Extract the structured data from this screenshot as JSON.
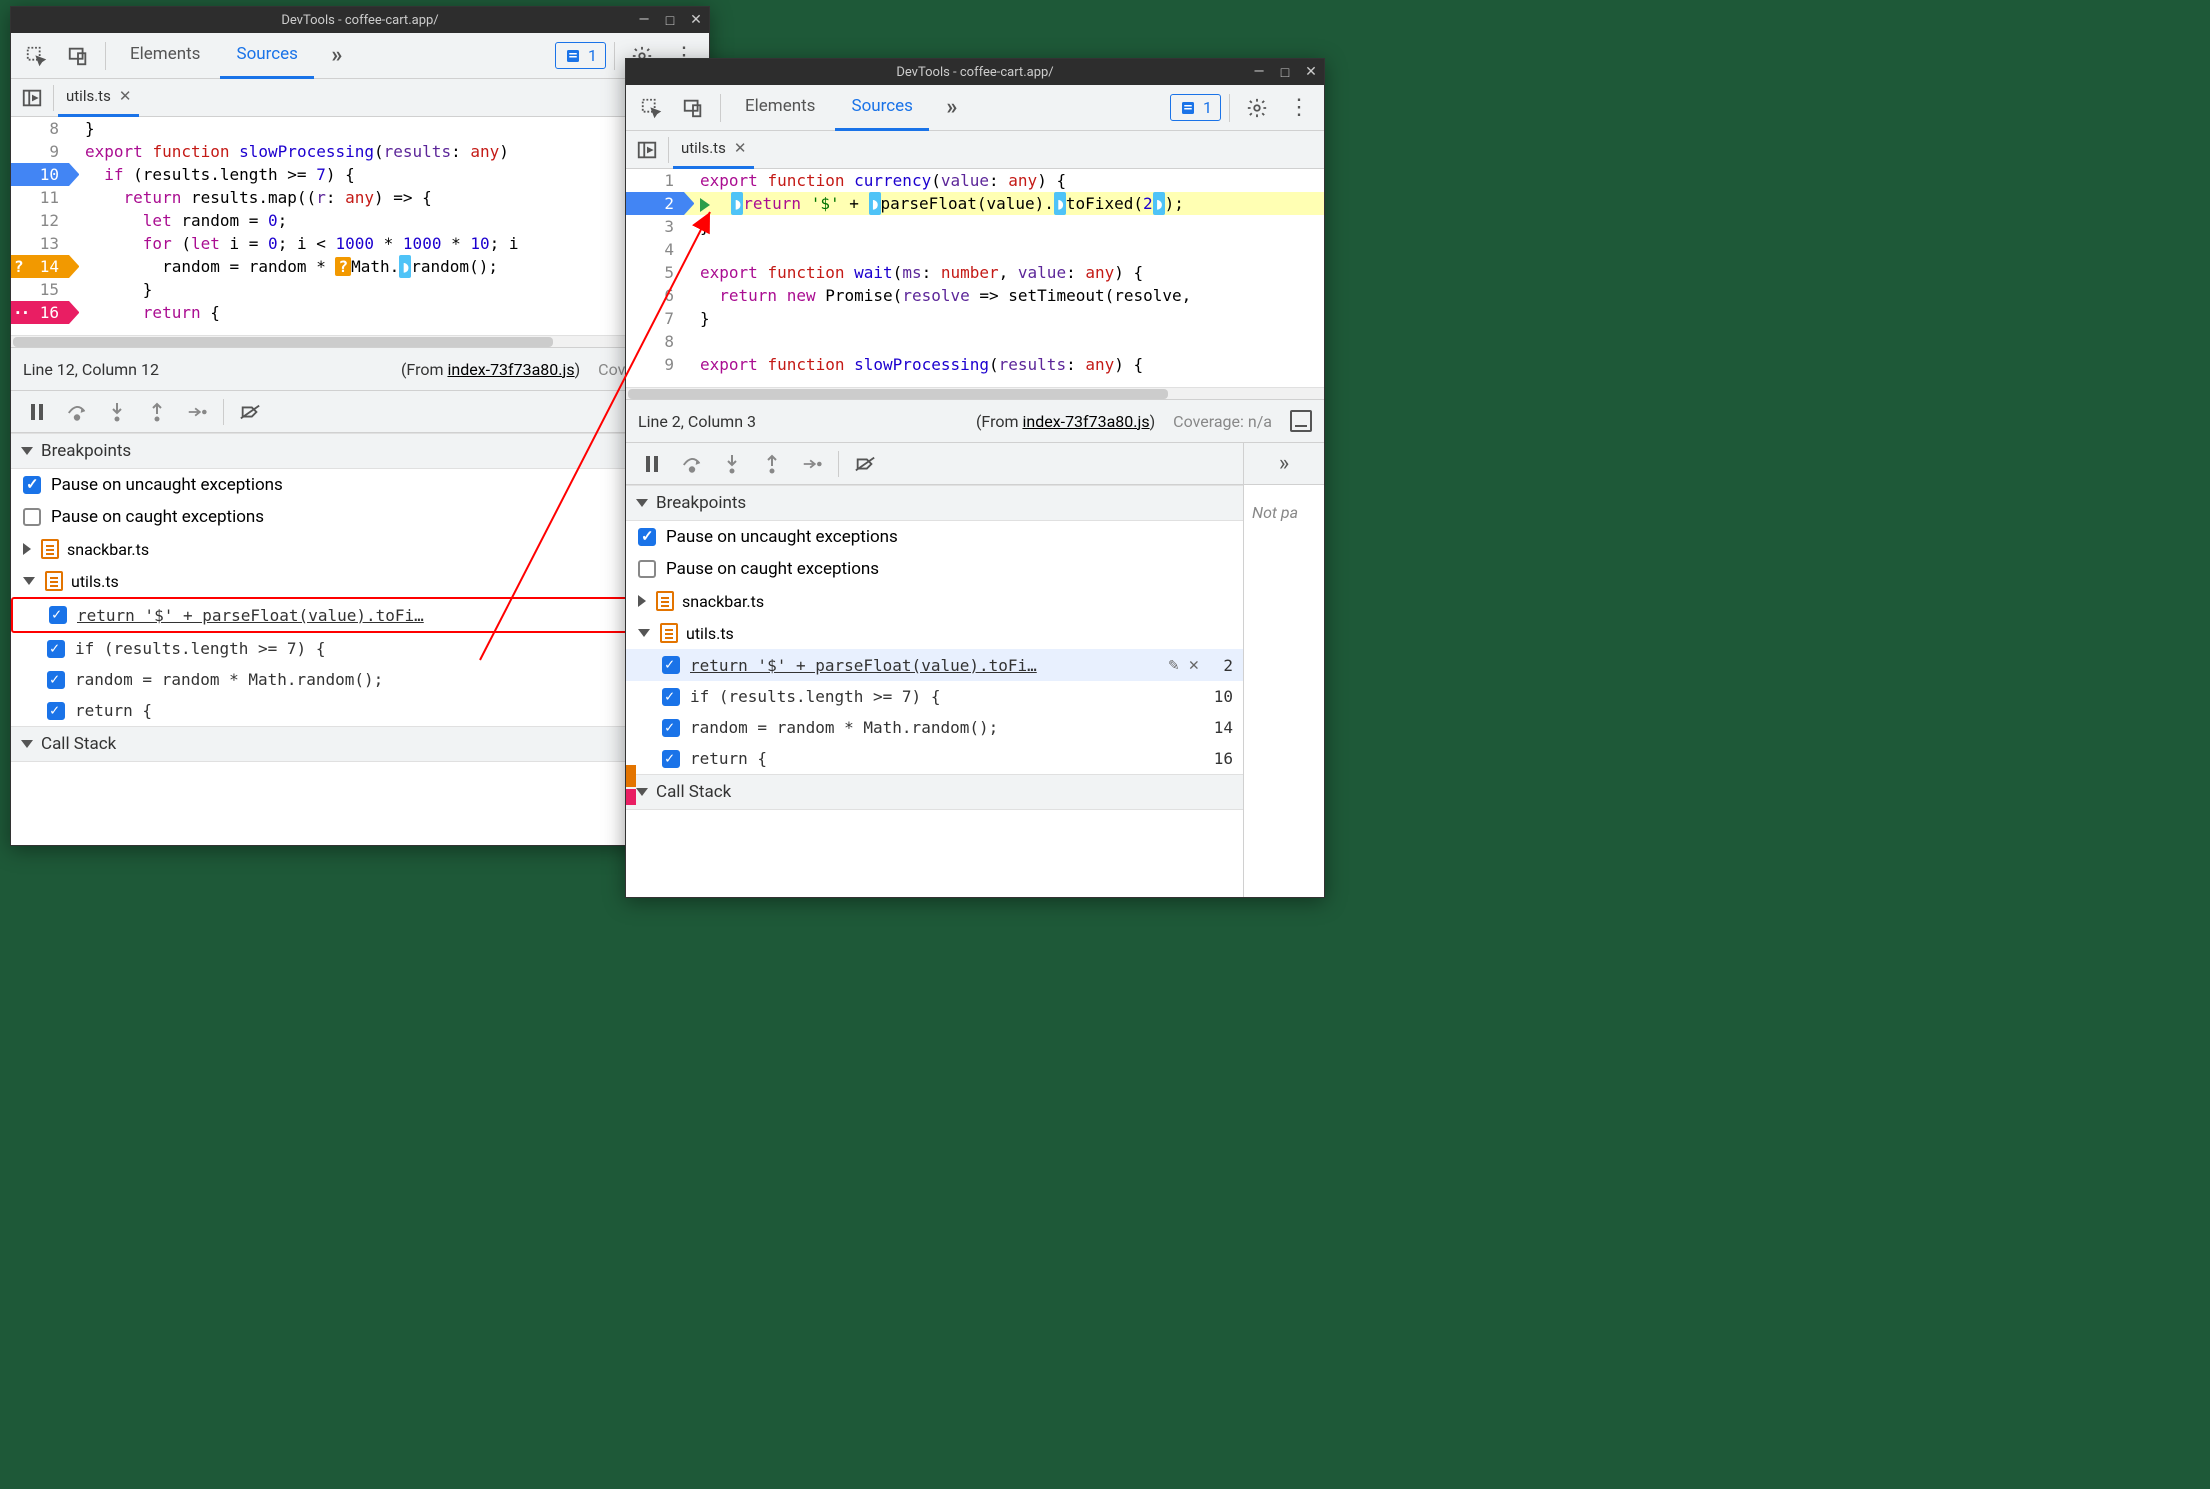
{
  "title": "DevTools - coffee-cart.app/",
  "nav_tabs": {
    "elements": "Elements",
    "sources": "Sources"
  },
  "issues_count": "1",
  "file_tab": "utils.ts",
  "left_window": {
    "status": {
      "position": "Line 12, Column 12",
      "from_prefix": "(From ",
      "from_link": "index-73f73a80.js",
      "from_suffix": ")",
      "coverage": "Coverage: n/a"
    },
    "code": {
      "lines": [
        {
          "n": "8",
          "html": "}"
        },
        {
          "n": "9",
          "html": "<span class='kw-export'>export</span> <span class='kw-func'>function</span> <span class='kw-name'>slowProcessing</span>(<span class='kw-param'>results</span>: <span class='kw-type'>any</span>)"
        },
        {
          "n": "10",
          "bp": "blue",
          "html": "  <span class='kw-ctrl'>if</span> (results.length &gt;= <span class='kw-num'>7</span>) {"
        },
        {
          "n": "11",
          "html": "    <span class='kw-ctrl'>return</span> results.map((<span class='kw-param'>r</span>: <span class='kw-type'>any</span>) =&gt; {"
        },
        {
          "n": "12",
          "html": "      <span class='kw-ctrl'>let</span> random = <span class='kw-num'>0</span>;"
        },
        {
          "n": "13",
          "html": "      <span class='kw-ctrl'>for</span> (<span class='kw-ctrl'>let</span> i = <span class='kw-num'>0</span>; i &lt; <span class='kw-num'>1000</span> * <span class='kw-num'>1000</span> * <span class='kw-num'>10</span>; i"
        },
        {
          "n": "14",
          "bp": "orange",
          "html": "        random = random * <span class='pill-orange'>?</span>Math.<span class='pill-blue'>◗</span>random();"
        },
        {
          "n": "15",
          "html": "      }"
        },
        {
          "n": "16",
          "bp": "pink",
          "html": "      <span class='kw-ctrl'>return</span> {"
        }
      ]
    }
  },
  "right_window": {
    "status": {
      "position": "Line 2, Column 3",
      "from_prefix": "(From ",
      "from_link": "index-73f73a80.js",
      "from_suffix": ")",
      "coverage": "Coverage: n/a"
    },
    "code": {
      "lines": [
        {
          "n": "1",
          "html": "<span class='kw-export'>export</span> <span class='kw-func'>function</span> <span class='kw-name'>currency</span>(<span class='kw-param'>value</span>: <span class='kw-type'>any</span>) {"
        },
        {
          "n": "2",
          "bp": "blue",
          "hl": true,
          "exec": true,
          "html": "  <span class='pill-blue'>◗</span><span class='kw-ctrl'>return</span> <span class='kw-str'>'$'</span> + <span class='pill-blue'>◗</span>parseFloat(value).<span class='pill-blue'>◗</span>toFixed(<span class='kw-num'>2</span><span class='pill-blue'>◗</span>);"
        },
        {
          "n": "3",
          "html": "}"
        },
        {
          "n": "4",
          "html": ""
        },
        {
          "n": "5",
          "html": "<span class='kw-export'>export</span> <span class='kw-func'>function</span> <span class='kw-name'>wait</span>(<span class='kw-param'>ms</span>: <span class='kw-type'>number</span>, <span class='kw-param'>value</span>: <span class='kw-type'>any</span>) {"
        },
        {
          "n": "6",
          "html": "  <span class='kw-ctrl'>return</span> <span class='kw-ctrl'>new</span> Promise(<span class='kw-param'>resolve</span> =&gt; setTimeout(resolve,"
        },
        {
          "n": "7",
          "html": "}"
        },
        {
          "n": "8",
          "html": ""
        },
        {
          "n": "9",
          "html": "<span class='kw-export'>export</span> <span class='kw-func'>function</span> <span class='kw-name'>slowProcessing</span>(<span class='kw-param'>results</span>: <span class='kw-type'>any</span>) {"
        }
      ]
    },
    "right_panel_text": "Not pa"
  },
  "breakpoints": {
    "header": "Breakpoints",
    "pause_uncaught": "Pause on uncaught exceptions",
    "pause_caught": "Pause on caught exceptions",
    "files": [
      {
        "name": "snackbar.ts",
        "expanded": false
      },
      {
        "name": "utils.ts",
        "expanded": true,
        "items": [
          {
            "text": "return '$' + parseFloat(value).toFi…",
            "text_r": "return '$' + parseFloat(value).toFi…",
            "line": "2",
            "selected": true,
            "editable": true
          },
          {
            "text": "if (results.length >= 7) {",
            "line": "10"
          },
          {
            "text": "random = random * Math.random();",
            "line": "14"
          },
          {
            "text": "return {",
            "line": "16"
          }
        ]
      }
    ]
  },
  "callstack_header": "Call Stack"
}
